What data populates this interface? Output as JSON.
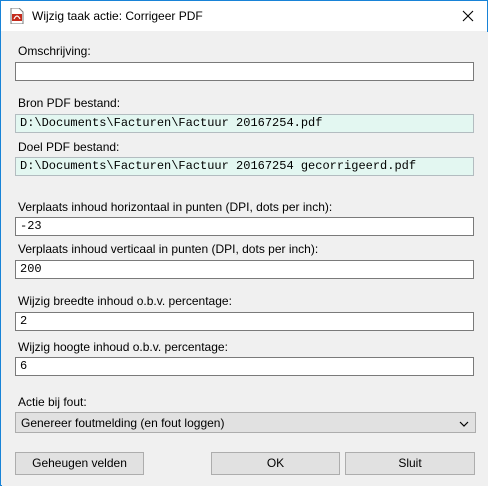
{
  "window": {
    "title": "Wijzig taak actie: Corrigeer PDF"
  },
  "fields": {
    "description": {
      "label": "Omschrijving:",
      "value": ""
    },
    "source_pdf": {
      "label": "Bron PDF bestand:",
      "value": "D:\\Documents\\Facturen\\Factuur 20167254.pdf"
    },
    "target_pdf": {
      "label": "Doel PDF bestand:",
      "value": "D:\\Documents\\Facturen\\Factuur 20167254 gecorrigeerd.pdf"
    },
    "shift_horizontal": {
      "label": "Verplaats inhoud horizontaal in punten (DPI, dots per inch):",
      "value": "-23"
    },
    "shift_vertical": {
      "label": "Verplaats inhoud verticaal in punten (DPI, dots per inch):",
      "value": "200"
    },
    "width_percentage": {
      "label": "Wijzig breedte inhoud o.b.v. percentage:",
      "value": "2"
    },
    "height_percentage": {
      "label": "Wijzig hoogte inhoud o.b.v. percentage:",
      "value": "6"
    }
  },
  "error_action": {
    "label": "Actie bij fout:",
    "selected": "Genereer foutmelding (en fout loggen)"
  },
  "buttons": {
    "save_fields": "Geheugen velden",
    "ok": "OK",
    "close": "Sluit"
  },
  "colors": {
    "window_border": "#1883d7",
    "readonly_field": "#e3f7f1",
    "app_icon": "#c42b1c"
  },
  "icons": {
    "app": "pdf-document-icon",
    "close": "close-icon",
    "dropdown": "chevron-down-icon"
  }
}
